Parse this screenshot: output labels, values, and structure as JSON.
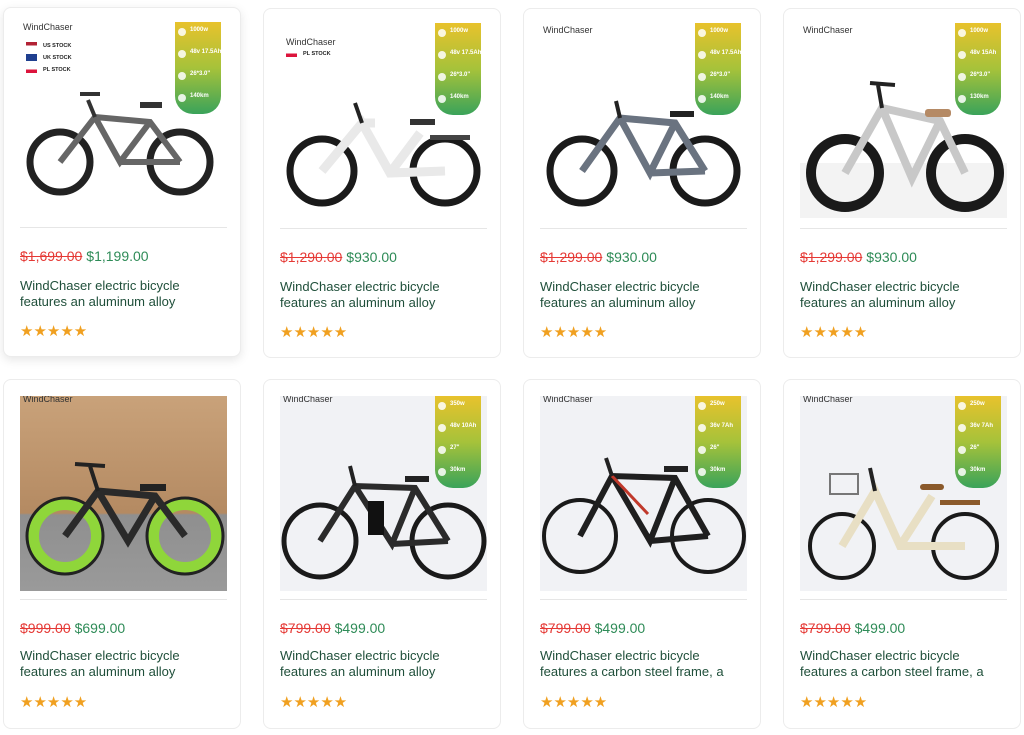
{
  "products": [
    {
      "brand": "WindChaser",
      "stock": [
        "US STOCK",
        "UK STOCK",
        "PL STOCK"
      ],
      "specs": [
        "1000w",
        "48v 17.5Ah",
        "26*3.0\"",
        "140km"
      ],
      "old_price": "$1,699.00",
      "new_price": "$1,199.00",
      "title": "WindChaser electric bicycle features an aluminum alloy",
      "rating": 5,
      "rating_stars": "★★★★★"
    },
    {
      "brand": "WindChaser",
      "stock": [
        "PL STOCK"
      ],
      "specs": [
        "1000w",
        "48v 17.5Ah",
        "26*3.0\"",
        "140km"
      ],
      "old_price": "$1,290.00",
      "new_price": "$930.00",
      "title": "WindChaser electric bicycle features an aluminum alloy",
      "rating": 5,
      "rating_stars": "★★★★★"
    },
    {
      "brand": "WindChaser",
      "stock": [],
      "specs": [
        "1000w",
        "48v 17.5Ah",
        "26*3.0\"",
        "140km"
      ],
      "old_price": "$1,299.00",
      "new_price": "$930.00",
      "title": "WindChaser electric bicycle features an aluminum alloy",
      "rating": 5,
      "rating_stars": "★★★★★"
    },
    {
      "brand": "WindChaser",
      "stock": [],
      "specs": [
        "1000w",
        "48v 15Ah",
        "26*3.0\"",
        "130km"
      ],
      "old_price": "$1,299.00",
      "new_price": "$930.00",
      "title": "WindChaser electric bicycle features an aluminum alloy",
      "rating": 5,
      "rating_stars": "★★★★★"
    },
    {
      "brand": "WindChaser",
      "stock": [],
      "specs": [
        "500w",
        "48v 15Ah",
        "26\"",
        "50km"
      ],
      "old_price": "$999.00",
      "new_price": "$699.00",
      "title": "WindChaser electric bicycle features an aluminum alloy",
      "rating": 5,
      "rating_stars": "★★★★★"
    },
    {
      "brand": "WindChaser",
      "stock": [],
      "specs": [
        "350w",
        "48v 10Ah",
        "27\"",
        "30km"
      ],
      "old_price": "$799.00",
      "new_price": "$499.00",
      "title": "WindChaser electric bicycle features an aluminum alloy",
      "rating": 5,
      "rating_stars": "★★★★★"
    },
    {
      "brand": "WindChaser",
      "stock": [],
      "specs": [
        "250w",
        "36v 7Ah",
        "26\"",
        "30km"
      ],
      "old_price": "$799.00",
      "new_price": "$499.00",
      "title": "WindChaser electric bicycle features a carbon steel frame, a",
      "rating": 5,
      "rating_stars": "★★★★★"
    },
    {
      "brand": "WindChaser",
      "stock": [],
      "specs": [
        "250w",
        "36v 7Ah",
        "26\"",
        "30km"
      ],
      "old_price": "$799.00",
      "new_price": "$499.00",
      "title": "WindChaser electric bicycle features a carbon steel frame, a",
      "rating": 5,
      "rating_stars": "★★★★★"
    }
  ],
  "colors": {
    "old_price": "#e53935",
    "new_price": "#2e8b57",
    "title": "#1f4f3a",
    "stars": "#f0a020"
  }
}
